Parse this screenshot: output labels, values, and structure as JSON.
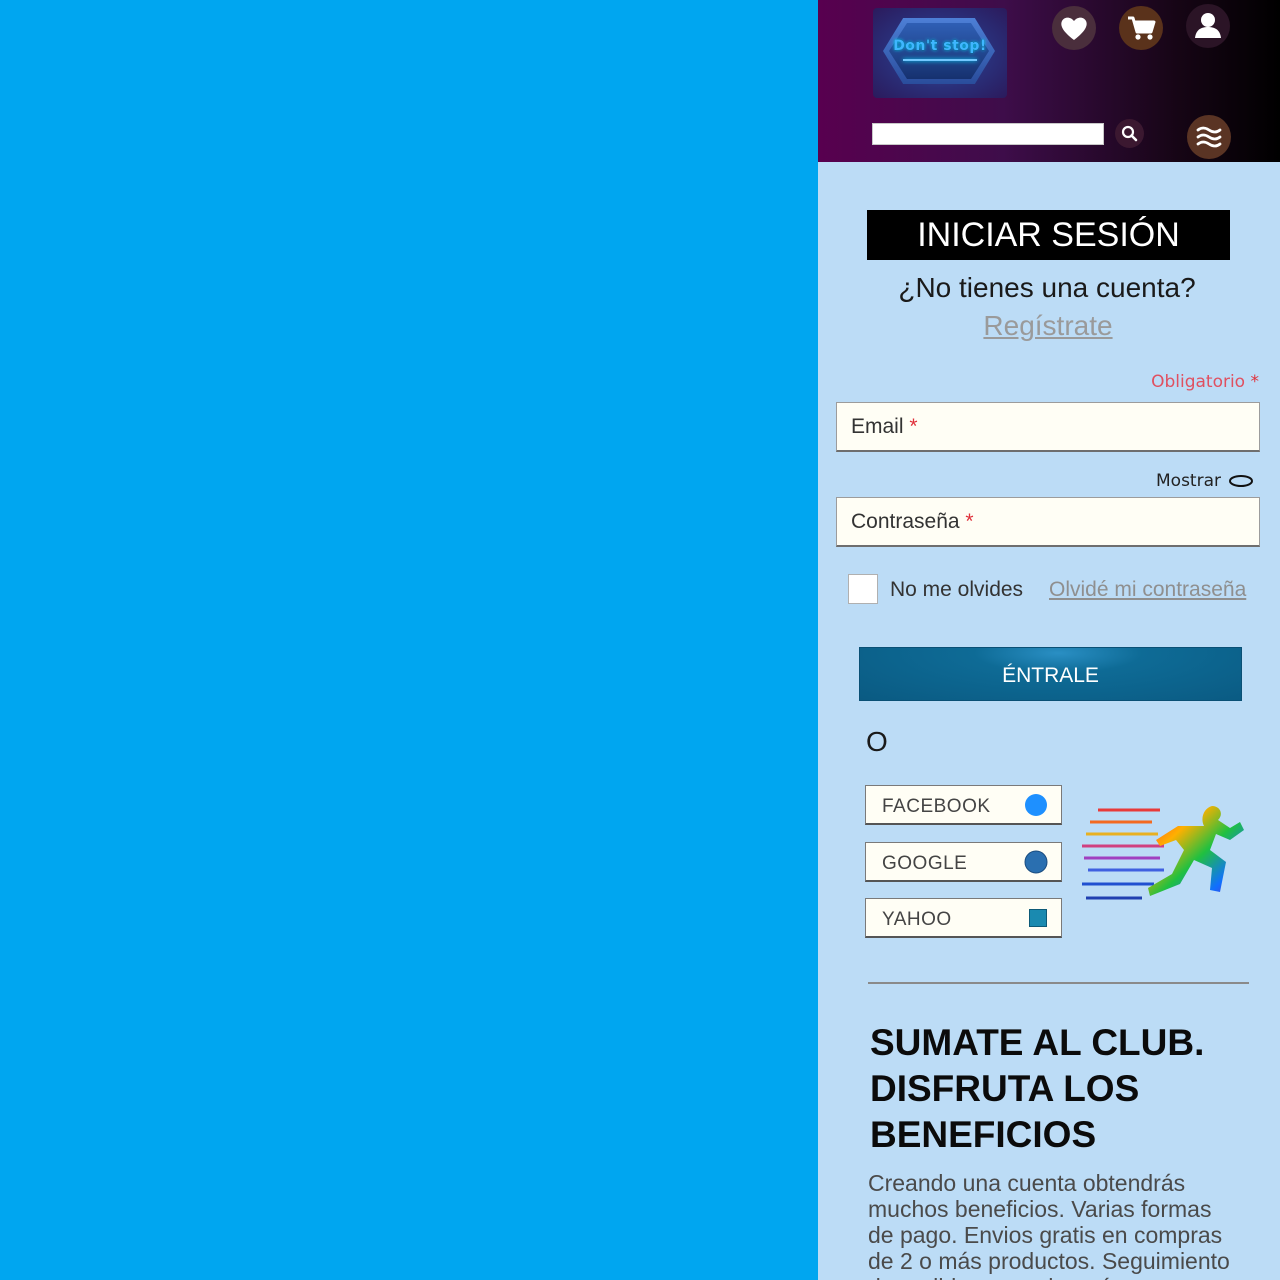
{
  "header": {
    "logo_text": "Don't stop!",
    "search_placeholder": "",
    "icons": {
      "wishlist": "heart-icon",
      "cart": "cart-icon",
      "account": "user-icon",
      "search": "search-icon",
      "menu": "menu-icon"
    }
  },
  "login": {
    "title": "INICIAR SESIÓN",
    "no_account": "¿No tienes una cuenta?",
    "register_link": "Regístrate",
    "required_note": "Obligatorio",
    "required_mark": "*",
    "email_label": "Email",
    "show_label": "Mostrar",
    "password_label": "Contraseña",
    "remember_label": "No me olvides",
    "forgot_link": "Olvidé mi contraseña",
    "submit_label": "ÉNTRALE",
    "or_text": "O"
  },
  "social": [
    {
      "label": "FACEBOOK",
      "icon": "facebook-icon",
      "color": "#1e90ff"
    },
    {
      "label": "GOOGLE",
      "icon": "google-icon",
      "color": "#2a6fb0"
    },
    {
      "label": "YAHOO",
      "icon": "yahoo-icon",
      "color": "#1a8ab0"
    }
  ],
  "club": {
    "title_line1": "SUMATE AL CLUB.",
    "title_line2": "DISFRUTA LOS",
    "title_line3": "BENEFICIOS",
    "description": "Creando una cuenta obtendrás muchos beneficios. Varias formas de pago. Envios gratis en compras de 2 o más productos. Seguimiento de pedidos y mucho más."
  },
  "colors": {
    "background": "#00a6f0",
    "panel": "#bcdcf6",
    "button": "#0a5a82",
    "required": "#e0323c"
  }
}
